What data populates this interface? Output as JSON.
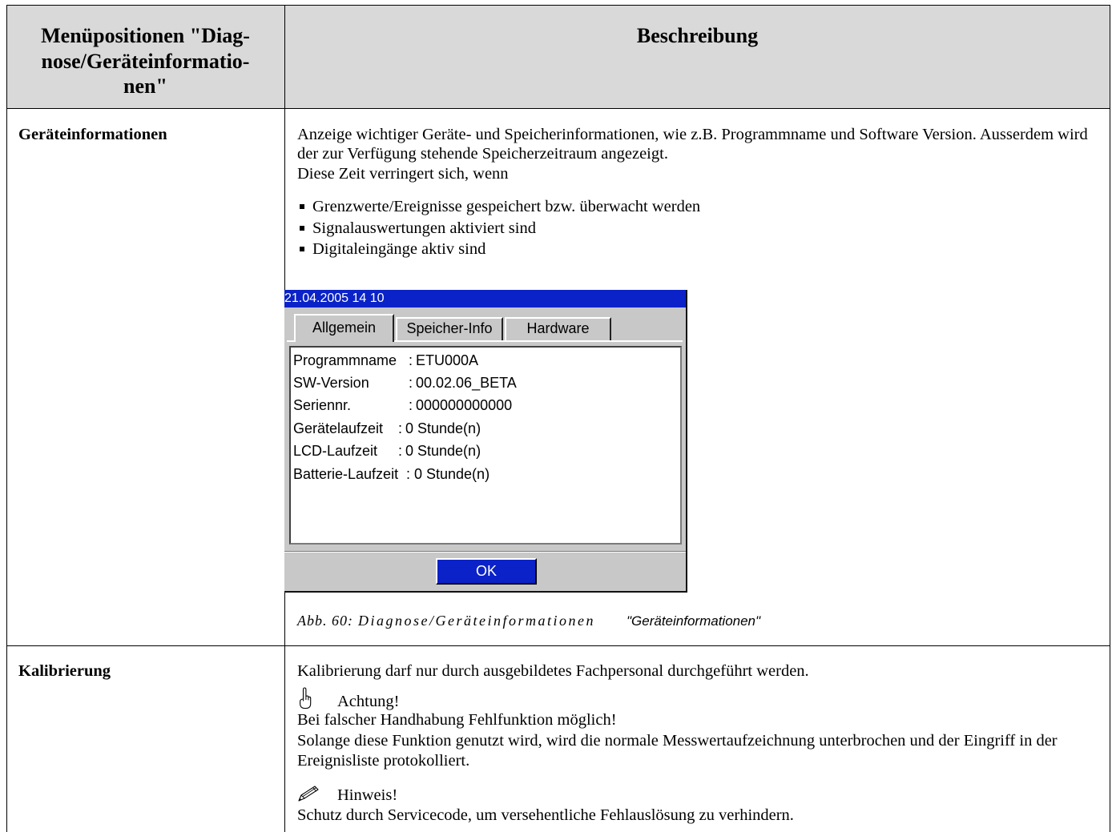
{
  "header": {
    "left_lines": [
      "Menüpositionen \"Diag-",
      "nose/Geräteinformatio-",
      "nen\""
    ],
    "right": "Beschreibung"
  },
  "rows": {
    "device_info": {
      "menu_item": "Geräteinformationen",
      "intro_lines": [
        "Anzeige wichtiger Geräte- und Speicherinformationen, wie z.B. Programmname und Software Version. Ausserdem wird",
        "der zur Verfügung stehende Speicherzeitraum angezeigt.",
        "Diese Zeit verringert sich, wenn"
      ],
      "bullets": [
        "Grenzwerte/Ereignisse gespeichert bzw. überwacht werden",
        "Signalauswertungen aktiviert sind",
        "Digitaleingänge aktiv sind"
      ],
      "figure": {
        "label": "Abb. 60:",
        "caption": "Diagnose/Geräteinformationen",
        "caption_emphasis": "\"Geräteinformationen\""
      }
    },
    "calibration": {
      "menu_item": "Kalibrierung",
      "intro": "Kalibrierung darf nur durch ausgebildetes Fachpersonal durchgeführt werden.",
      "warning": {
        "icon": "pointing-hand-icon",
        "title": "Achtung!",
        "lines": [
          "Bei falscher Handhabung Fehlfunktion möglich!",
          "Solange diese Funktion genutzt wird, wird die normale Messwertaufzeichnung unterbrochen und der Eingriff in der",
          "Ereignisliste protokolliert."
        ]
      },
      "note": {
        "icon": "pencil-icon",
        "title": "Hinweis!",
        "text": "Schutz durch Servicecode, um versehentliche Fehlauslösung zu verhindern."
      }
    }
  },
  "device_screen": {
    "datetime": "21.04.2005 14 10",
    "tabs": [
      {
        "label": "Allgemein",
        "active": true
      },
      {
        "label": "Speicher-Info",
        "active": false
      },
      {
        "label": "Hardware",
        "active": false
      }
    ],
    "separator": ":",
    "info_rows": [
      {
        "label": "Programmname",
        "value": "ETU000A"
      },
      {
        "label": "SW-Version",
        "value": "00.02.06_BETA"
      },
      {
        "label": "Seriennr.",
        "value": "000000000000"
      },
      {
        "label": "Gerätelaufzeit",
        "value": "0 Stunde(n)"
      },
      {
        "label": "LCD-Laufzeit",
        "value": "0 Stunde(n)"
      },
      {
        "label": "Batterie-Laufzeit",
        "value": "0 Stunde(n)"
      }
    ],
    "ok_button": "OK"
  },
  "colors": {
    "header_background": "#d9d9d9",
    "device_accent": "#0a22c8",
    "device_background": "#c8c8c8"
  }
}
